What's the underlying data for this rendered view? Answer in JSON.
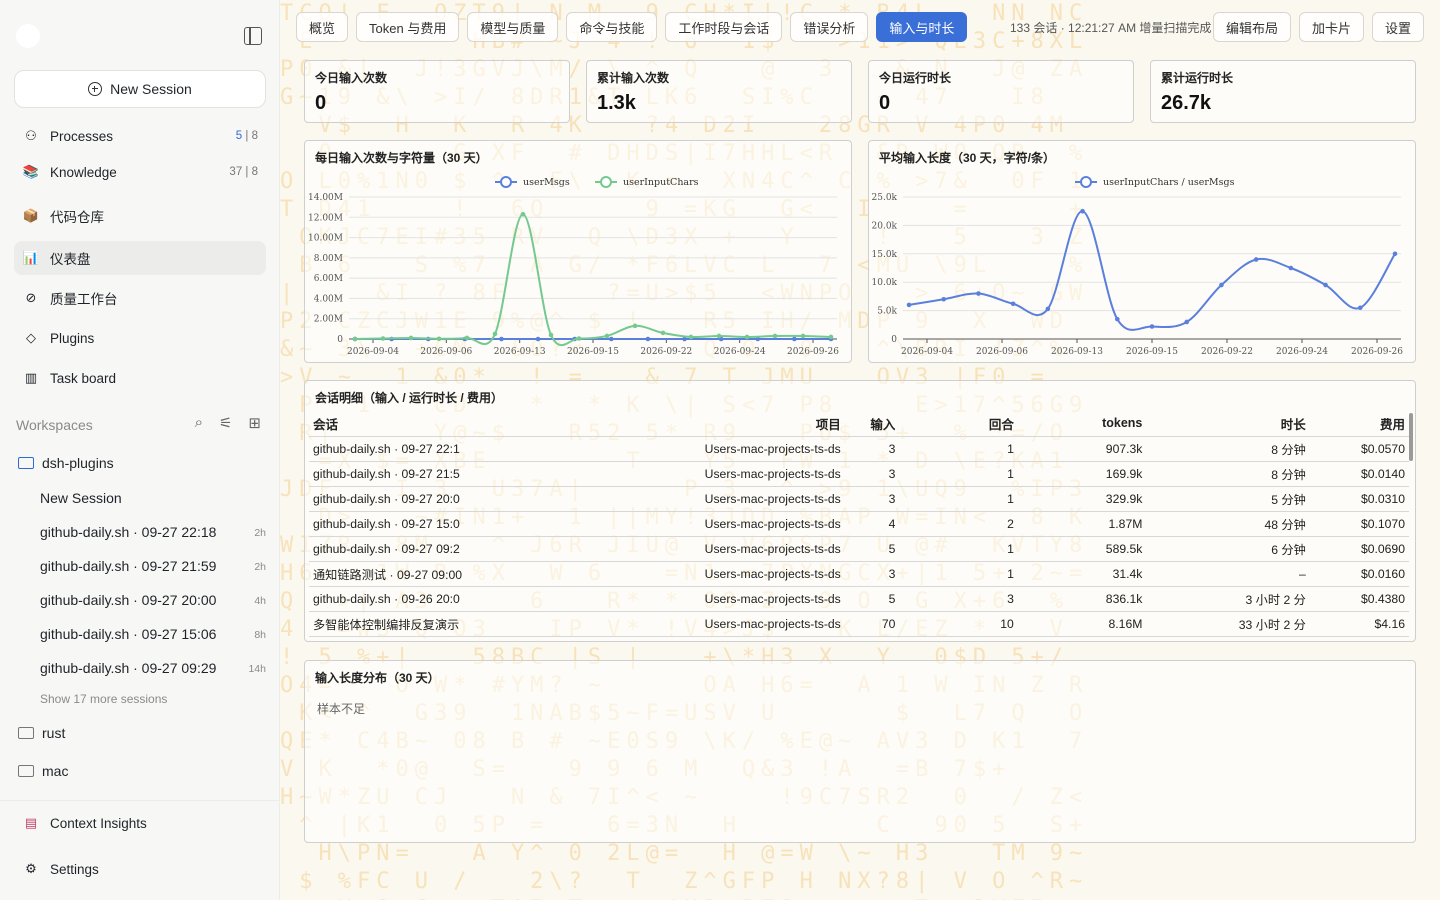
{
  "sidebar": {
    "new_session": "New Session",
    "nav": [
      {
        "label": "Processes",
        "count_a": "5",
        "count_b": "8"
      },
      {
        "label": "Knowledge",
        "count": "37 | 8"
      },
      {
        "label": "代码仓库"
      },
      {
        "label": "仪表盘"
      },
      {
        "label": "质量工作台"
      },
      {
        "label": "Plugins"
      },
      {
        "label": "Task board"
      }
    ],
    "workspaces_label": "Workspaces",
    "workspace_active": "dsh-plugins",
    "sessions": [
      {
        "title": "New Session",
        "age": ""
      },
      {
        "title": "github-daily.sh · 09-27 22:18",
        "age": "2h"
      },
      {
        "title": "github-daily.sh · 09-27 21:59",
        "age": "2h"
      },
      {
        "title": "github-daily.sh · 09-27 20:00",
        "age": "4h"
      },
      {
        "title": "github-daily.sh · 09-27 15:06",
        "age": "8h"
      },
      {
        "title": "github-daily.sh · 09-27 09:29",
        "age": "14h"
      }
    ],
    "show_more": "Show 17 more sessions",
    "other_workspaces": [
      "rust",
      "mac"
    ],
    "context_insights": "Context Insights",
    "settings": "Settings"
  },
  "tabs": [
    "概览",
    "Token 与费用",
    "模型与质量",
    "命令与技能",
    "工作时段与会话",
    "错误分析",
    "输入与时长"
  ],
  "active_tab_index": 6,
  "status": "133 会话 · 12:21:27 AM 增量扫描完成",
  "right_buttons": [
    "编辑布局",
    "加卡片",
    "设置"
  ],
  "kpis": [
    {
      "title": "今日输入次数",
      "value": "0"
    },
    {
      "title": "累计输入次数",
      "value": "1.3k"
    },
    {
      "title": "今日运行时长",
      "value": "0"
    },
    {
      "title": "累计运行时长",
      "value": "26.7k"
    }
  ],
  "colors": {
    "accent": "#3b6fd8",
    "series_blue": "#5b7fdc",
    "series_green": "#74c98f"
  },
  "chart_data": [
    {
      "type": "line",
      "title": "每日输入次数与字符量（30 天）",
      "x_ticks": [
        "2026-09-04",
        "2026-09-06",
        "2026-09-13",
        "2026-09-15",
        "2026-09-22",
        "2026-09-24",
        "2026-09-26"
      ],
      "y_ticks": [
        "0",
        "2.00M",
        "4.00M",
        "6.00M",
        "8.00M",
        "10.00M",
        "12.00M",
        "14.00M"
      ],
      "ylim": [
        0,
        14000000
      ],
      "series": [
        {
          "name": "userMsgs",
          "values": [
            0,
            0,
            0,
            0,
            0,
            0,
            0,
            0,
            0,
            0,
            0,
            0,
            0,
            0
          ]
        },
        {
          "name": "userInputChars",
          "values": [
            0,
            50000,
            100000,
            20000,
            100000,
            500000,
            12300000,
            400000,
            50000,
            300000,
            1300000,
            600000,
            200000,
            300000,
            200000,
            300000,
            300000,
            200000
          ]
        }
      ],
      "legend": "top-center"
    },
    {
      "type": "line",
      "title": "平均输入长度（30 天，字符/条）",
      "x_ticks": [
        "2026-09-04",
        "2026-09-06",
        "2026-09-13",
        "2026-09-15",
        "2026-09-22",
        "2026-09-24",
        "2026-09-26"
      ],
      "y_ticks": [
        "0",
        "5.0k",
        "10.0k",
        "15.0k",
        "20.0k",
        "25.0k"
      ],
      "ylim": [
        0,
        25000
      ],
      "series": [
        {
          "name": "userInputChars / userMsgs",
          "values": [
            6000,
            7000,
            8000,
            6200,
            5300,
            22500,
            3500,
            2200,
            3000,
            9500,
            14000,
            12500,
            9500,
            5500,
            15000
          ]
        }
      ],
      "legend": "top-center"
    }
  ],
  "session_table": {
    "title": "会话明细（输入 / 运行时长 / 费用）",
    "columns": [
      "会话",
      "项目",
      "输入",
      "回合",
      "tokens",
      "时长",
      "费用"
    ],
    "rows": [
      [
        "github-daily.sh · 09-27 22:1",
        "Users-mac-projects-ts-ds",
        "3",
        "1",
        "907.3k",
        "8 分钟",
        "$0.0570"
      ],
      [
        "github-daily.sh · 09-27 21:5",
        "Users-mac-projects-ts-ds",
        "3",
        "1",
        "169.9k",
        "8 分钟",
        "$0.0140"
      ],
      [
        "github-daily.sh · 09-27 20:0",
        "Users-mac-projects-ts-ds",
        "3",
        "1",
        "329.9k",
        "5 分钟",
        "$0.0310"
      ],
      [
        "github-daily.sh · 09-27 15:0",
        "Users-mac-projects-ts-ds",
        "4",
        "2",
        "1.87M",
        "48 分钟",
        "$0.1070"
      ],
      [
        "github-daily.sh · 09-27 09:2",
        "Users-mac-projects-ts-ds",
        "5",
        "1",
        "589.5k",
        "6 分钟",
        "$0.0690"
      ],
      [
        "通知链路测试 · 09-27 09:00",
        "Users-mac-projects-ts-ds",
        "3",
        "1",
        "31.4k",
        "–",
        "$0.0160"
      ],
      [
        "github-daily.sh · 09-26 20:0",
        "Users-mac-projects-ts-ds",
        "5",
        "3",
        "836.1k",
        "3 小时 2 分",
        "$0.4380"
      ],
      [
        "多智能体控制编排反复演示",
        "Users-mac-projects-ts-ds",
        "70",
        "10",
        "8.16M",
        "33 小时 2 分",
        "$4.16"
      ]
    ]
  },
  "distribution": {
    "title": "输入长度分布（30 天）",
    "empty": "样本不足"
  }
}
